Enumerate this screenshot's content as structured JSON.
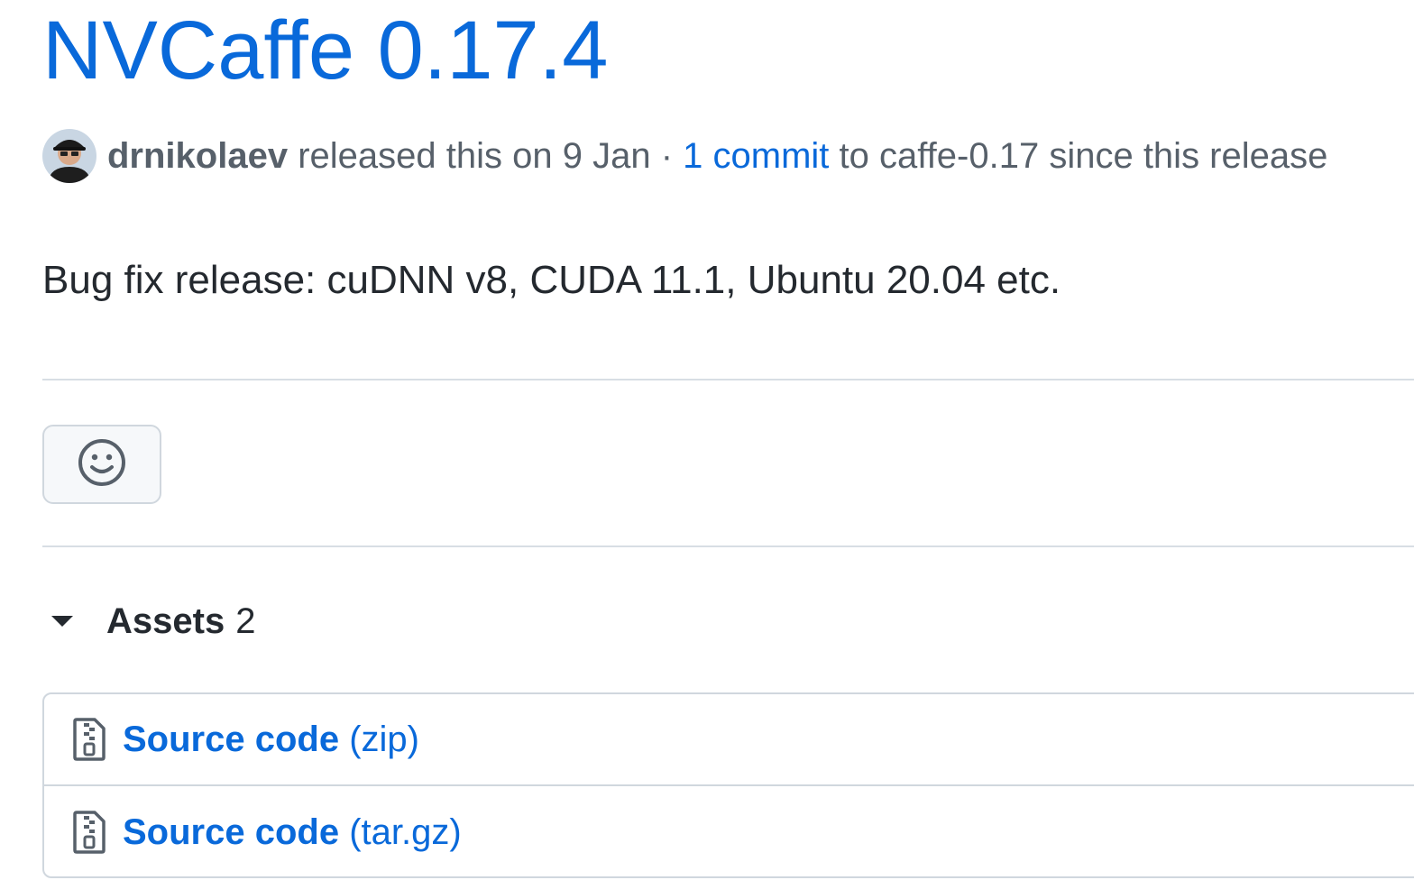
{
  "release": {
    "title": "NVCaffe 0.17.4",
    "author": "drnikolaev",
    "released_text": "released this on",
    "date": "9 Jan",
    "separator": "·",
    "commits_link": "1 commit",
    "to_text": "to",
    "branch": "caffe-0.17",
    "since_text": "since this release",
    "notes": "Bug fix release: cuDNN v8, CUDA 11.1, Ubuntu 20.04 etc.",
    "avatar_icon": "user-avatar"
  },
  "reactions": {
    "icon": "smiley-icon"
  },
  "assets": {
    "title": "Assets",
    "count": "2",
    "caret_icon": "triangle-down-icon",
    "items": [
      {
        "name": "Source code",
        "ext": "(zip)",
        "icon": "file-zip-icon"
      },
      {
        "name": "Source code",
        "ext": "(tar.gz)",
        "icon": "file-zip-icon"
      }
    ]
  },
  "colors": {
    "link": "#0969da",
    "text": "#24292f",
    "muted": "#57606a",
    "border": "#d0d7de",
    "button_bg": "#f6f8fa"
  }
}
